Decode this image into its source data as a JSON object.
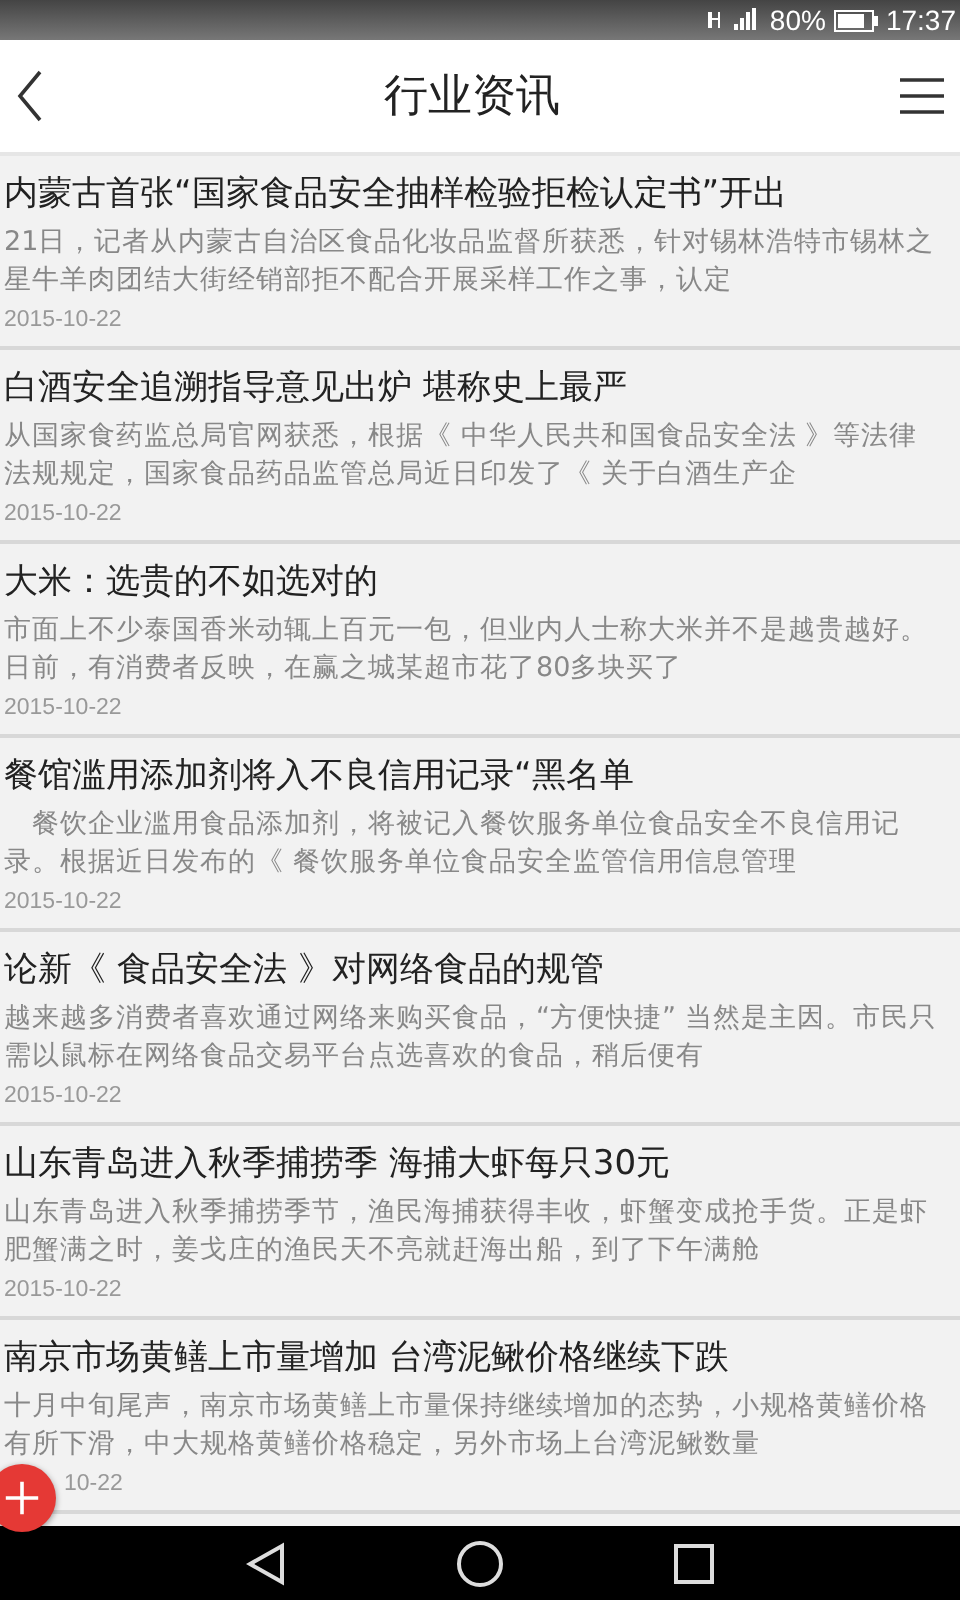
{
  "status_bar": {
    "battery": "80%",
    "time": "17:37"
  },
  "header": {
    "title": "行业资讯"
  },
  "articles": [
    {
      "title": "内蒙古首张“国家食品安全抽样检验拒检认定书”开出",
      "summary": "21日，记者从内蒙古自治区食品化妆品监督所获悉，针对锡林浩特市锡林之星牛羊肉团结大街经销部拒不配合开展采样工作之事，认定",
      "date": "2015-10-22"
    },
    {
      "title": "白酒安全追溯指导意见出炉 堪称史上最严",
      "summary": "从国家食药监总局官网获悉，根据《 中华人民共和国食品安全法 》等法律法规规定，国家食品药品监管总局近日印发了《 关于白酒生产企",
      "date": "2015-10-22"
    },
    {
      "title": "大米：选贵的不如选对的",
      "summary": "市面上不少泰国香米动辄上百元一包，但业内人士称大米并不是越贵越好。日前，有消费者反映，在赢之城某超市花了80多块买了",
      "date": "2015-10-22"
    },
    {
      "title": "餐馆滥用添加剂将入不良信用记录“黑名单",
      "summary": "　餐饮企业滥用食品添加剂，将被记入餐饮服务单位食品安全不良信用记录。根据近日发布的《 餐饮服务单位食品安全监管信用信息管理",
      "date": "2015-10-22"
    },
    {
      "title": "论新《 食品安全法 》对网络食品的规管",
      "summary": "越来越多消费者喜欢通过网络来购买食品，“方便快捷” 当然是主因。市民只需以鼠标在网络食品交易平台点选喜欢的食品，稍后便有",
      "date": "2015-10-22"
    },
    {
      "title": "山东青岛进入秋季捕捞季 海捕大虾每只30元",
      "summary": "山东青岛进入秋季捕捞季节，渔民海捕获得丰收，虾蟹变成抢手货。正是虾肥蟹满之时，姜戈庄的渔民天不亮就赶海出船，到了下午满舱",
      "date": "2015-10-22"
    },
    {
      "title": "南京市场黄鳝上市量增加 台湾泥鳅价格继续下跌",
      "summary": "十月中旬尾声，南京市场黄鳝上市量保持继续增加的态势，小规格黄鳝价格有所下滑，中大规格黄鳝价格稳定，另外市场上台湾泥鳅数量",
      "date": "10-22"
    }
  ]
}
